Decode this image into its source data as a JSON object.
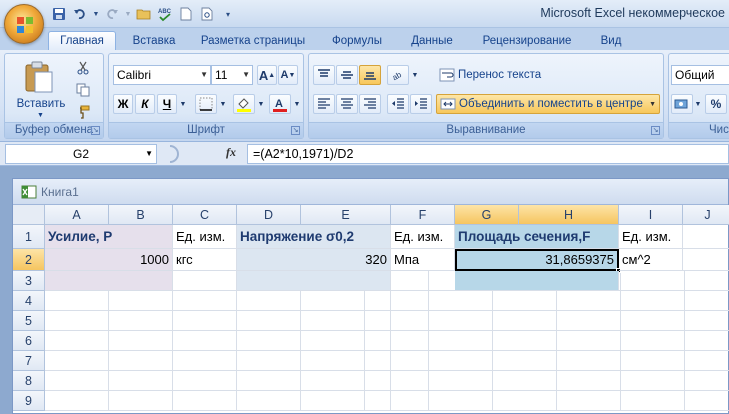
{
  "app": {
    "title": "Microsoft Excel некоммерческое",
    "icons": {
      "save": "save-icon",
      "undo": "undo-icon",
      "redo": "redo-icon",
      "open": "open-folder-icon",
      "spell": "spellcheck-icon",
      "new": "new-document-icon",
      "print": "print-preview-icon",
      "customize": "customize-qat-icon"
    }
  },
  "tabs": [
    {
      "label": "Главная",
      "active": true
    },
    {
      "label": "Вставка"
    },
    {
      "label": "Разметка страницы"
    },
    {
      "label": "Формулы"
    },
    {
      "label": "Данные"
    },
    {
      "label": "Рецензирование"
    },
    {
      "label": "Вид"
    }
  ],
  "ribbon": {
    "clipboard": {
      "paste_label": "Вставить",
      "group_label": "Буфер обмена"
    },
    "font": {
      "font_name": "Calibri",
      "font_size": "11",
      "bold": "Ж",
      "italic": "К",
      "underline": "Ч",
      "group_label": "Шрифт"
    },
    "alignment": {
      "wrap_text": "Перенос текста",
      "merge_center": "Объединить и поместить в центре",
      "group_label": "Выравнивание"
    },
    "number": {
      "format": "Общий",
      "percent": "%",
      "group_label_partial": "Чис"
    }
  },
  "formula_bar": {
    "name_box": "G2",
    "fx": "fx",
    "formula": "=(A2*10,1971)/D2"
  },
  "workbook": {
    "title": "Книга1"
  },
  "sheet": {
    "columns": [
      "A",
      "B",
      "C",
      "D",
      "E",
      "F",
      "G",
      "H",
      "I",
      "J"
    ],
    "rows": [
      "1",
      "2",
      "3",
      "4",
      "5",
      "6",
      "7",
      "8",
      "9"
    ],
    "selected_column": "G",
    "selected_columns": [
      "G",
      "H"
    ],
    "selected_row": "2",
    "cells": {
      "A1": "Усилие, P",
      "C1": "Ед. изм.",
      "D1": "Напряжение σ0,2",
      "F1": "Ед. изм.",
      "G1": "Площадь сечения,F",
      "I1": "Ед. изм.",
      "B2": "1000",
      "C2": "кгс",
      "E2": "320",
      "F2": "Мпа",
      "H2": "31,8659375",
      "I2": "см^2"
    }
  },
  "colors": {
    "accent": "#15428b",
    "selection": "#f5c560",
    "cell_fill_lavender": "#e6e0ec",
    "cell_fill_blue": "#dce6f1",
    "cell_fill_selected": "#b7d7e8"
  }
}
